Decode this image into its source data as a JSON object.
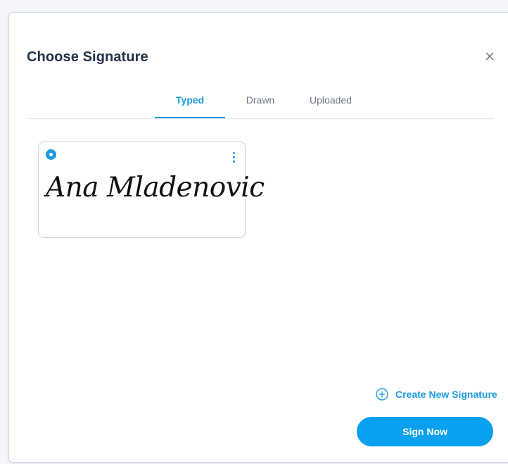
{
  "dialog": {
    "title": "Choose Signature"
  },
  "tabs": [
    {
      "label": "Typed",
      "active": true
    },
    {
      "label": "Drawn",
      "active": false
    },
    {
      "label": "Uploaded",
      "active": false
    }
  ],
  "signatures": [
    {
      "text": "Ana Mladenovic",
      "selected": true
    }
  ],
  "actions": {
    "create_label": "Create New Signature",
    "sign_label": "Sign Now"
  },
  "icons": {
    "close": "close-icon",
    "radio": "radio-selected-icon",
    "more": "kebab-menu-icon",
    "add": "plus-circle-icon"
  },
  "colors": {
    "accent": "#1a9be0",
    "button": "#0aa0f0",
    "title": "#23324a"
  }
}
